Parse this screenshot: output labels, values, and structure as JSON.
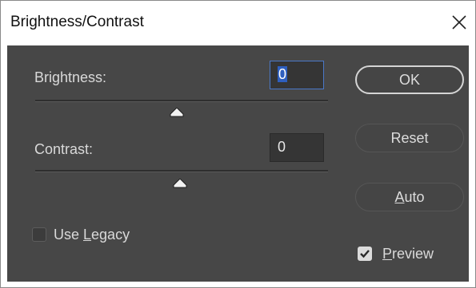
{
  "window": {
    "title": "Brightness/Contrast",
    "close_icon": "close-icon"
  },
  "brightness": {
    "label": "Brightness:",
    "value": "0",
    "slider_value": 0
  },
  "contrast": {
    "label": "Contrast:",
    "value": "0",
    "slider_value": 0
  },
  "buttons": {
    "ok": "OK",
    "reset": "Reset",
    "auto": {
      "mnemonic": "A",
      "rest": "uto"
    }
  },
  "use_legacy": {
    "before": "Use ",
    "mnemonic": "L",
    "after": "egacy",
    "checked": false
  },
  "preview": {
    "mnemonic": "P",
    "rest": "review",
    "checked": true
  },
  "colors": {
    "panel": "#474747",
    "field": "#353535",
    "selection": "#2e5fbf",
    "text": "#d9d9d9"
  }
}
